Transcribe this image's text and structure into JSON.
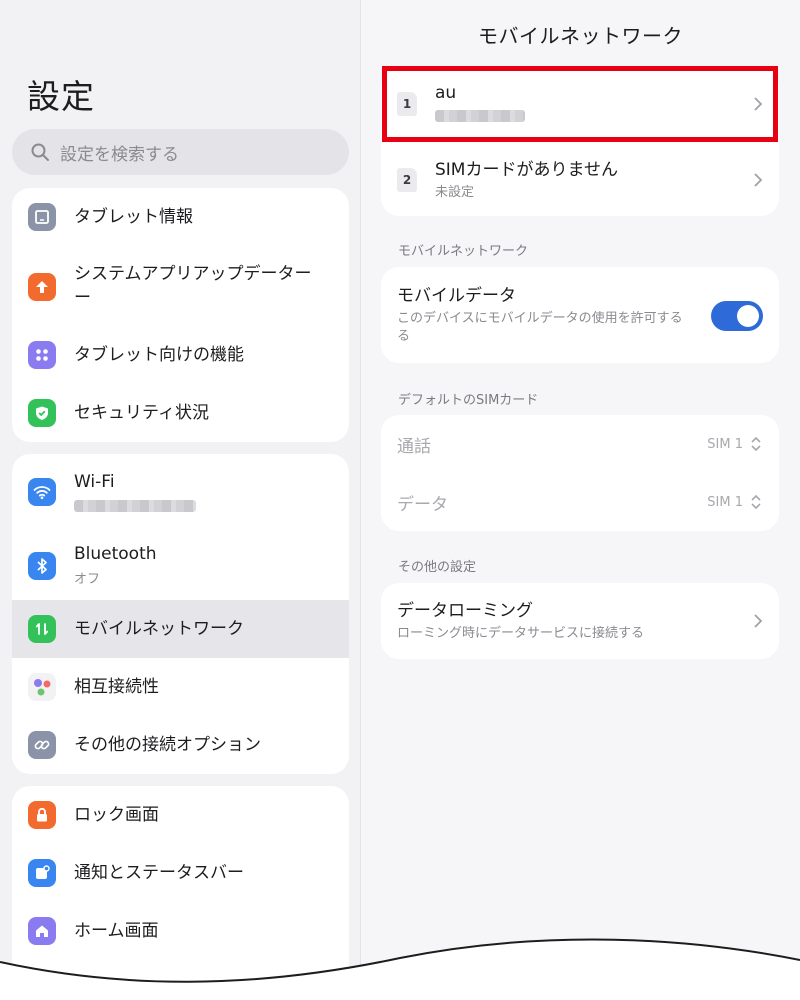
{
  "left": {
    "title": "設定",
    "search": {
      "placeholder": "設定を検索する"
    },
    "group1": [
      {
        "label": "タブレット情報",
        "icon": "tablet-icon",
        "color": "#8a93a8"
      },
      {
        "label": "システムアプリアップデーター",
        "label2": "ー",
        "icon": "arrow-up-icon",
        "color": "#f26a2e"
      },
      {
        "label": "タブレット向けの機能",
        "icon": "grid-dots-icon",
        "color": "#8a7cf0"
      },
      {
        "label": "セキュリティ状況",
        "icon": "shield-check-icon",
        "color": "#33c25a"
      }
    ],
    "group2": [
      {
        "label": "Wi-Fi",
        "icon": "wifi-icon",
        "color": "#3a86f0"
      },
      {
        "label": "Bluetooth",
        "sub": "オフ",
        "icon": "bluetooth-icon",
        "color": "#3a86f0"
      },
      {
        "label": "モバイルネットワーク",
        "icon": "mobile-data-icon",
        "color": "#33c25a"
      },
      {
        "label": "相互接続性",
        "icon": "dots-cluster-icon",
        "color": "#f2f2f4"
      },
      {
        "label": "その他の接続オプション",
        "icon": "link-icon",
        "color": "#8a93a8"
      }
    ],
    "group3": [
      {
        "label": "ロック画面",
        "icon": "lock-icon",
        "color": "#f26a2e"
      },
      {
        "label": "通知とステータスバー",
        "icon": "notification-icon",
        "color": "#3a86f0"
      },
      {
        "label": "ホーム画面",
        "icon": "home-icon",
        "color": "#8a7cf0"
      }
    ]
  },
  "right": {
    "title": "モバイルネットワーク",
    "sims": [
      {
        "badge": "1",
        "name": "au"
      },
      {
        "badge": "2",
        "name": "SIMカードがありません",
        "sub": "未設定"
      }
    ],
    "section_mobile": "モバイルネットワーク",
    "mobile_data": {
      "title": "モバイルデータ",
      "sub": "このデバイスにモバイルデータの使用を許可する",
      "sub2": "る",
      "enabled": true
    },
    "section_default_sim": "デフォルトのSIMカード",
    "call": {
      "label": "通話",
      "value": "SIM 1"
    },
    "data": {
      "label": "データ",
      "value": "SIM 1"
    },
    "section_other": "その他の設定",
    "roaming": {
      "title": "データローミング",
      "sub": "ローミング時にデータサービスに接続する"
    }
  },
  "colors": {
    "accent": "#2f6bd8",
    "highlight": "#e60012"
  }
}
